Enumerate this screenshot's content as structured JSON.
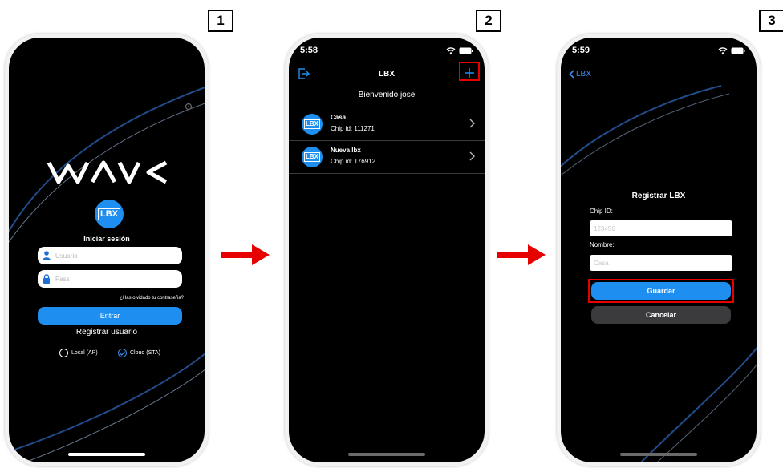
{
  "steps": [
    "1",
    "2",
    "3"
  ],
  "colors": {
    "accent_blue": "#1e8ff0",
    "highlight_red": "#e60000",
    "background": "#000000"
  },
  "screen1": {
    "logo_text": "WAVE",
    "badge_text": "LBX",
    "heading": "Iniciar sesión",
    "username_placeholder": "Usuario",
    "password_placeholder": "Pass",
    "forgot_link": "¿Has olvidado tu contraseña?",
    "login_button": "Entrar",
    "register_link": "Registrar usuario",
    "mode_local": "Local (AP)",
    "mode_cloud": "Cloud (STA)",
    "selected_mode": "Cloud (STA)",
    "icons": [
      "user-icon",
      "lock-icon",
      "settings-icon",
      "radio-off-icon",
      "radio-on-icon"
    ]
  },
  "screen2": {
    "time": "5:58",
    "nav_title": "LBX",
    "welcome": "Bienvenido jose",
    "items": [
      {
        "name": "Casa",
        "chip": "Chip id: 111271"
      },
      {
        "name": "Nueva lbx",
        "chip": "Chip id: 176912"
      }
    ],
    "icons": [
      "logout-icon",
      "plus-icon",
      "chevron-right-icon",
      "wifi-icon",
      "battery-icon"
    ]
  },
  "screen3": {
    "time": "5:59",
    "back_label": "LBX",
    "form_title": "Registrar LBX",
    "chip_label": "Chip ID:",
    "chip_placeholder": "123456",
    "name_label": "Nombre:",
    "name_placeholder": "Casa",
    "save_button": "Guardar",
    "cancel_button": "Cancelar",
    "icons": [
      "chevron-left-icon",
      "wifi-icon",
      "battery-icon"
    ]
  }
}
